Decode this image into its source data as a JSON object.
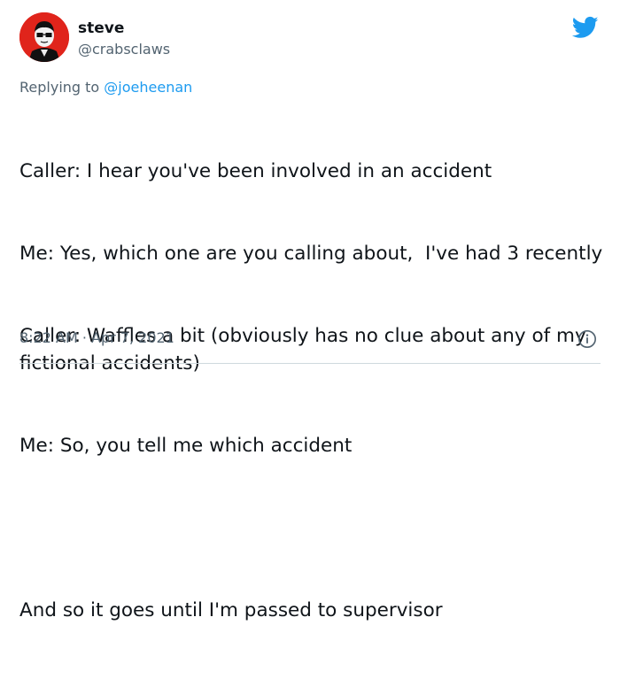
{
  "user": {
    "display_name": "steve",
    "handle": "@crabsclaws",
    "avatar_color": "#e0241b"
  },
  "reply": {
    "prefix": "Replying to ",
    "mention": "@joeheenan"
  },
  "tweet": {
    "lines": [
      "Caller: I hear you've been involved in an accident",
      "Me: Yes, which one are you calling about,  I've had 3 recently",
      "Caller: Waffles a bit (obviously has no clue about any of my fictional accidents)",
      "Me: So, you tell me which accident",
      "",
      "And so it goes until I'm passed to supervisor"
    ],
    "timestamp": "8:22 AM · Apr 7, 2021"
  },
  "icons": {
    "brand": "twitter-bird-icon",
    "info": "info-icon"
  },
  "colors": {
    "brand_blue": "#1d9bf0",
    "secondary_text": "#536471",
    "divider": "#cfd9de"
  }
}
